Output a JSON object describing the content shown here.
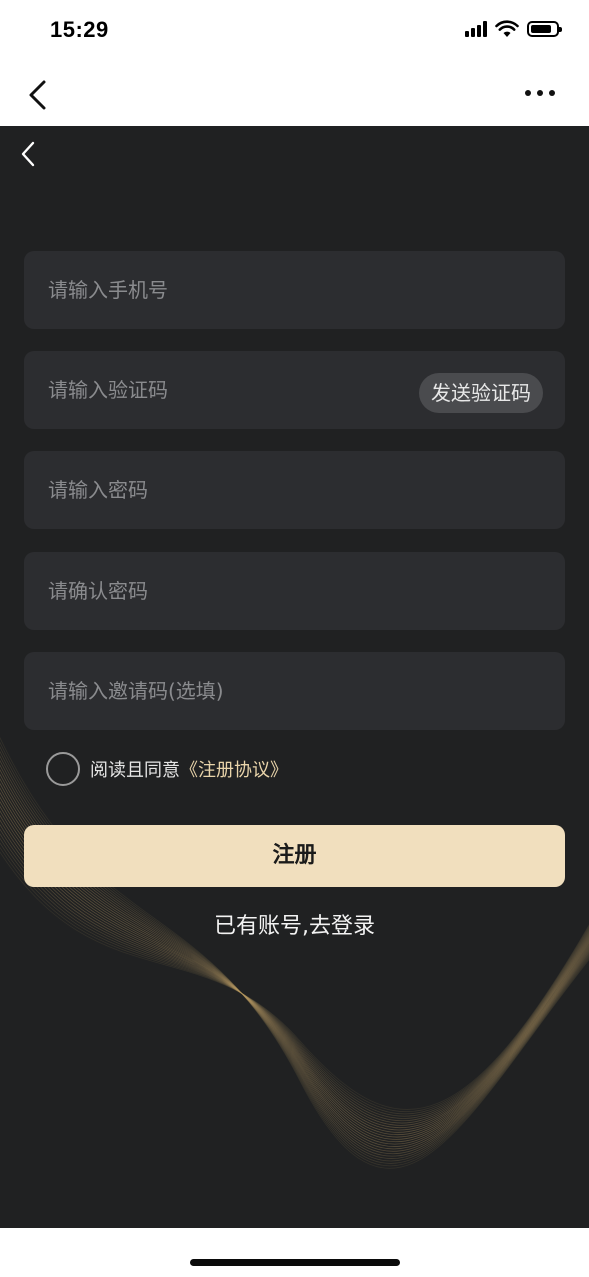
{
  "status_bar": {
    "time": "15:29"
  },
  "nav": {
    "back_icon": "chevron-left-icon",
    "more_icon": "more-horizontal-icon"
  },
  "form": {
    "phone_placeholder": "请输入手机号",
    "code_placeholder": "请输入验证码",
    "send_code_label": "发送验证码",
    "password_placeholder": "请输入密码",
    "confirm_password_placeholder": "请确认密码",
    "invite_placeholder": "请输入邀请码(选填)"
  },
  "agreement": {
    "text": "阅读且同意",
    "link": "《注册协议》"
  },
  "register_label": "注册",
  "login_link": "已有账号,去登录",
  "colors": {
    "background": "#202122",
    "field": "#2c2d30",
    "accent": "#f1dfbe",
    "link": "#e9d4aa"
  }
}
